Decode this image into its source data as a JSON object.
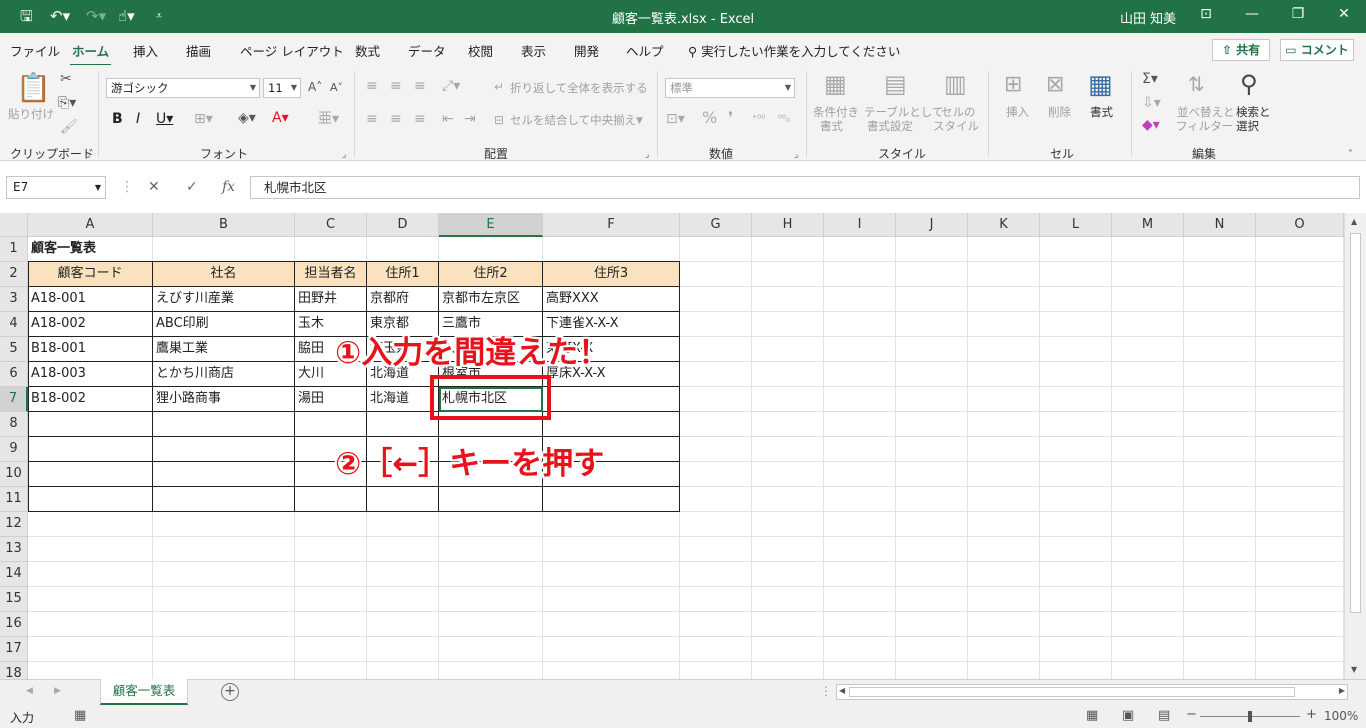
{
  "titlebar": {
    "title": "顧客一覧表.xlsx  -  Excel",
    "user": "山田 知美"
  },
  "menu": {
    "tabs": [
      "ファイル",
      "ホーム",
      "挿入",
      "描画",
      "ページ レイアウト",
      "数式",
      "データ",
      "校閲",
      "表示",
      "開発",
      "ヘルプ"
    ],
    "active": "ホーム",
    "tell_me": "実行したい作業を入力してください",
    "share": "共有",
    "comment": "コメント"
  },
  "ribbon": {
    "clipboard": {
      "label": "クリップボード",
      "paste": "貼り付け"
    },
    "font": {
      "label": "フォント",
      "name": "游ゴシック",
      "size": "11"
    },
    "alignment": {
      "label": "配置",
      "wrap": "折り返して全体を表示する",
      "merge": "セルを結合して中央揃え"
    },
    "number": {
      "label": "数値",
      "format": "標準"
    },
    "styles": {
      "label": "スタイル",
      "cond1": "条件付き",
      "cond2": "書式",
      "table1": "テーブルとして",
      "table2": "書式設定",
      "cell1": "セルの",
      "cell2": "スタイル"
    },
    "cells": {
      "label": "セル",
      "insert": "挿入",
      "delete": "削除",
      "format": "書式"
    },
    "editing": {
      "label": "編集",
      "sort1": "並べ替えと",
      "sort2": "フィルター",
      "find1": "検索と",
      "find2": "選択"
    }
  },
  "formula_bar": {
    "name_box": "E7",
    "content": "札幌市北区"
  },
  "columns": [
    "A",
    "B",
    "C",
    "D",
    "E",
    "F",
    "G",
    "H",
    "I",
    "J",
    "K",
    "L",
    "M",
    "N",
    "O"
  ],
  "rows": [
    "1",
    "2",
    "3",
    "4",
    "5",
    "6",
    "7",
    "8",
    "9",
    "10",
    "11",
    "12",
    "13",
    "14",
    "15",
    "16",
    "17",
    "18"
  ],
  "sheet": {
    "title": "顧客一覧表",
    "headers": [
      "顧客コード",
      "社名",
      "担当者名",
      "住所1",
      "住所2",
      "住所3"
    ],
    "data": [
      [
        "A18-001",
        "えびす川産業",
        "田野井",
        "京都府",
        "京都市左京区",
        "高野XXX"
      ],
      [
        "A18-002",
        "ABC印刷",
        "玉木",
        "東京都",
        "三鷹市",
        "下連雀X-X-X"
      ],
      [
        "B18-001",
        "鷹巣工業",
        "脇田",
        "埼玉県",
        "入間市",
        "東町X-X"
      ],
      [
        "A18-003",
        "とかち川商店",
        "大川",
        "北海道",
        "根室市",
        "厚床X-X-X"
      ],
      [
        "B18-002",
        "狸小路商事",
        "湯田",
        "北海道",
        "札幌市北区",
        ""
      ]
    ]
  },
  "annotations": {
    "step1": "①入力を間違えた！",
    "step2": "②［←］キーを押す"
  },
  "sheet_tab": "顧客一覧表",
  "status": {
    "mode": "入力",
    "zoom": "100%"
  }
}
